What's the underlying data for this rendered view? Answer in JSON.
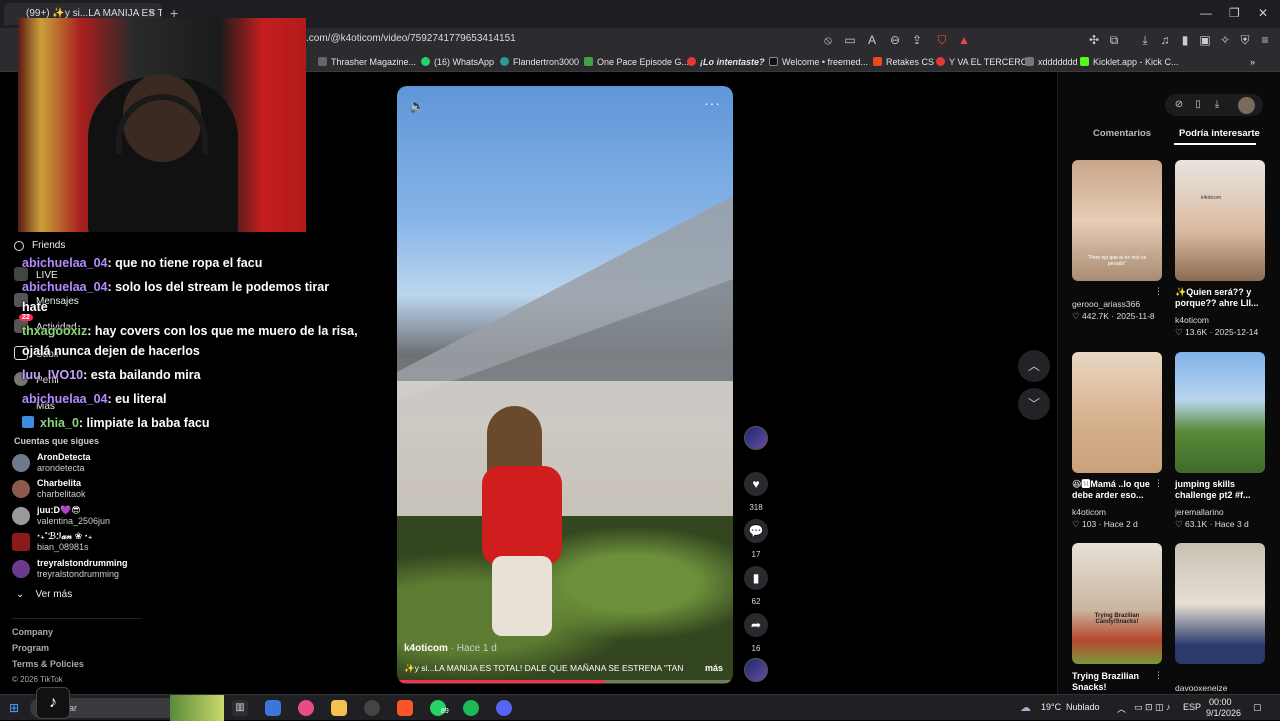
{
  "browser": {
    "tab_title": "(99+) ✨y si...LA MANIJA ES T",
    "url": ".com/@k4oticom/video/7592741779653414151",
    "bookmarks": [
      "Thrasher Magazine...",
      "(16) WhatsApp",
      "Flandertron3000",
      "One Pace Episode G...",
      "¡Lo intentaste?",
      "Welcome • freemed...",
      "Retakes CS",
      "Y VA EL TERCERO",
      "xddddddd",
      "Kicklet.app - Kick C..."
    ]
  },
  "sidebar": {
    "nav": [
      "Friends",
      "LIVE",
      "Mensajes",
      "Actividad",
      "Subir",
      "Perfil",
      "Más"
    ],
    "activity_badge": "22",
    "following_title": "Cuentas que sigues",
    "following": [
      {
        "name": "AronDetecta",
        "handle": "arondetecta"
      },
      {
        "name": "Charbelita",
        "handle": "charbelitaok"
      },
      {
        "name": "juu:D💜😎",
        "handle": "valentina_2506jun"
      },
      {
        "name": "‧₊˚ℬℐ𝒶𝓃 ❀ ‧₊",
        "handle": "bian_08981s"
      },
      {
        "name": "treyralstondrumming",
        "handle": "treyralstondrumming"
      }
    ],
    "see_more": "Ver más",
    "footer": [
      "Company",
      "Program",
      "Terms & Policies",
      "© 2026 TikTok"
    ]
  },
  "chat": [
    {
      "user": "abichuelaa_04",
      "text": ": que no tiene ropa el facu"
    },
    {
      "user": "abichuelaa_04",
      "text": ": solo los del stream le podemos tirar"
    },
    {
      "user": "",
      "text": "hate"
    },
    {
      "user": "thxagooxiz",
      "text": ": hay covers con los que me muero de la risa,"
    },
    {
      "user": "",
      "text": "ojalá nunca dejen de hacerlos"
    },
    {
      "user": "luu_IVO10",
      "text": ": esta bailando mira"
    },
    {
      "user": "abichuelaa_04",
      "text": ": eu literal"
    },
    {
      "user": "xhia_0",
      "text": ": limpiate la baba facu"
    }
  ],
  "video": {
    "author": "k4oticom",
    "time_ago": "· Hace 1 d",
    "caption": "✨y si...LA MANIJA ES TOTAL! DALE QUE MAÑANA SE ESTRENA \"TAN",
    "more": "más",
    "likes": "318",
    "comments": "17",
    "saves": "62",
    "shares": "16",
    "progress": 0.62
  },
  "right_panel": {
    "tabs": [
      "Comentarios",
      "Podría interesarte"
    ],
    "items": [
      {
        "title": "",
        "author": "gerooo_ariass366",
        "likes": "442.7K",
        "date": "2025-11-8",
        "overlay": "\"Pero ojo que el ex mío es pesado\""
      },
      {
        "title": "✨Quien será?? y porque?? ahre LII...",
        "author": "k4oticom",
        "likes": "13.6K",
        "date": "2025-12-14",
        "overlay": "k4oticom"
      },
      {
        "title": "😆🅼Mamá ..lo que debe arder eso...",
        "author": "k4oticom",
        "likes": "103",
        "date": "Hace 2 d",
        "overlay": ""
      },
      {
        "title": "jumping skills challenge pt2 #f...",
        "author": "jeremallarino",
        "likes": "63.1K",
        "date": "Hace 3 d",
        "overlay": ""
      },
      {
        "title": "Trying Brazilian Snacks!",
        "author": "",
        "likes": "",
        "date": "",
        "overlay": "Trying Brazilian Candy/Snacks!"
      },
      {
        "title": "",
        "author": "davooxeneize",
        "likes": "",
        "date": "",
        "overlay": ""
      }
    ]
  },
  "taskbar": {
    "search_placeholder": "scar",
    "whatsapp_badge": "89",
    "weather_temp": "19°C",
    "weather_desc": "Nublado",
    "lang": "ESP",
    "time": "00:00",
    "date": "9/1/2026"
  }
}
